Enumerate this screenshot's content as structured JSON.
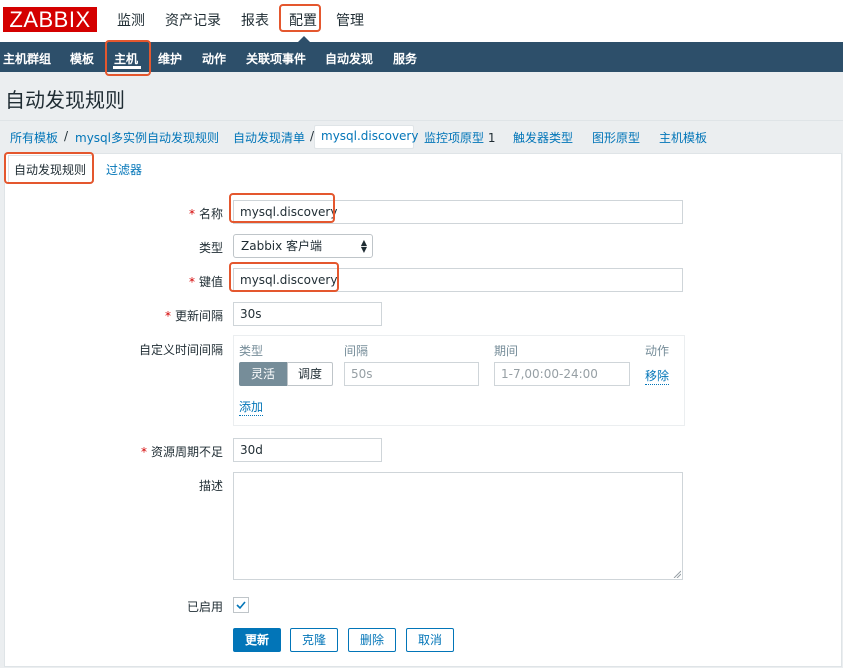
{
  "header": {
    "logo": "ZABBIX",
    "nav": [
      "监测",
      "资产记录",
      "报表",
      "配置",
      "管理"
    ],
    "active_nav": "配置"
  },
  "subnav": {
    "items": [
      "主机群组",
      "模板",
      "主机",
      "维护",
      "动作",
      "关联项事件",
      "自动发现",
      "服务"
    ],
    "active": "主机"
  },
  "page_title": "自动发现规则",
  "breadcrumb": {
    "all_templates": "所有模板",
    "sep": "/",
    "template": "mysql多实例自动发现规则",
    "discovery_list": "自动发现清单",
    "current": "mysql.discovery",
    "item_prototypes": "监控项原型",
    "item_prototypes_count": "1",
    "trigger_types": "触发器类型",
    "graph_prototypes": "图形原型",
    "host_templates": "主机模板"
  },
  "tabs": {
    "rule": "自动发现规则",
    "filter": "过滤器"
  },
  "form": {
    "required_mark": "*",
    "name_label": "名称",
    "name_value": "mysql.discovery",
    "type_label": "类型",
    "type_value": "Zabbix 客户端",
    "key_label": "键值",
    "key_value": "mysql.discovery",
    "interval_label": "更新间隔",
    "interval_value": "30s",
    "custom_intervals_label": "自定义时间间隔",
    "custom": {
      "col_type": "类型",
      "col_interval": "间隔",
      "col_period": "期间",
      "col_action": "动作",
      "flexible": "灵活",
      "scheduling": "调度",
      "interval_placeholder": "50s",
      "period_placeholder": "1-7,00:00-24:00",
      "remove": "移除",
      "add": "添加"
    },
    "lifetime_label": "资源周期不足",
    "lifetime_value": "30d",
    "description_label": "描述",
    "enabled_label": "已启用",
    "enabled": true
  },
  "buttons": {
    "update": "更新",
    "clone": "克隆",
    "delete": "删除",
    "cancel": "取消"
  },
  "colors": {
    "accent": "#0275b8",
    "highlight": "#e4572e",
    "subnav_bg": "#2d4f6a",
    "logo_bg": "#d40000"
  }
}
